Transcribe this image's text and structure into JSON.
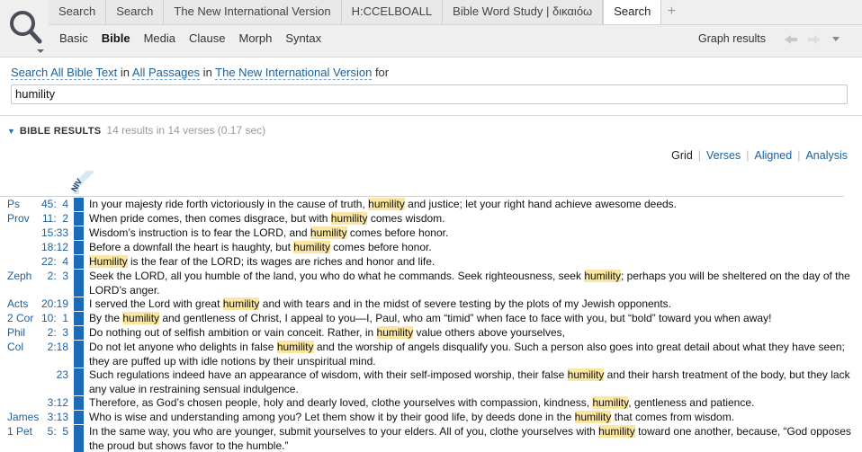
{
  "tabs": [
    "Search",
    "Search",
    "The New International Version",
    "H:CCELBOALL",
    "Bible Word Study | δικαιόω",
    "Search"
  ],
  "tab_add": "+",
  "subnav": [
    "Basic",
    "Bible",
    "Media",
    "Clause",
    "Morph",
    "Syntax"
  ],
  "graph_results": "Graph results",
  "query": {
    "prefix": "Search All Bible Text",
    "in1": " in ",
    "passages": "All Passages",
    "in2": " in ",
    "version": "The New International Version",
    "for": " for",
    "value": "humility"
  },
  "results_header": {
    "title": "BIBLE RESULTS",
    "count": "14 results in 14 verses (0.17 sec)"
  },
  "views": [
    "Grid",
    "Verses",
    "Aligned",
    "Analysis"
  ],
  "version_abbrev": "NIV",
  "colors": {
    "link": "#1f5f99",
    "accent": "#1c6bb8",
    "highlight": "#fbe6a2"
  },
  "results": [
    {
      "book": "Ps",
      "cv": "45:  4",
      "segs": [
        "In your majesty ride forth victoriously in the cause of truth, ",
        "humility",
        " and justice; let your right hand achieve awesome deeds."
      ]
    },
    {
      "book": "Prov",
      "cv": "11:  2",
      "segs": [
        "When pride comes, then comes disgrace, but with ",
        "humility",
        " comes wisdom."
      ]
    },
    {
      "book": "",
      "cv": "15:33",
      "segs": [
        "Wisdom’s instruction is to fear the L",
        "ORD",
        ", and ",
        "humility",
        " comes before honor."
      ],
      "lord_index": 1
    },
    {
      "book": "",
      "cv": "18:12",
      "segs": [
        "Before a downfall the heart is haughty, but ",
        "humility",
        " comes before honor."
      ]
    },
    {
      "book": "",
      "cv": "22:  4",
      "segs": [
        "",
        "Humility",
        " is the fear of the L",
        "ORD",
        "; its wages are riches and honor and life."
      ],
      "lord_index": 3
    },
    {
      "book": "Zeph",
      "cv": "2:  3",
      "lines": 2,
      "segs": [
        "Seek the L",
        "ORD",
        ", all you humble of the land, you who do what he commands. Seek righteousness, seek ",
        "humility",
        "; perhaps you will be sheltered on the day of the L",
        "ORD",
        "’s anger."
      ],
      "lord_index": 1,
      "lord_index2": 5
    },
    {
      "book": "Acts",
      "cv": "20:19",
      "segs": [
        "I served the Lord with great ",
        "humility",
        " and with tears and in the midst of severe testing by the plots of my Jewish opponents."
      ]
    },
    {
      "book": "2 Cor",
      "cv": "10:  1",
      "segs": [
        "By the ",
        "humility",
        " and gentleness of Christ, I appeal to you—I, Paul, who am “timid” when face to face with you, but “bold” toward you when away!"
      ]
    },
    {
      "book": "Phil",
      "cv": "2:  3",
      "segs": [
        "Do nothing out of selfish ambition or vain conceit. Rather, in ",
        "humility",
        " value others above yourselves,"
      ]
    },
    {
      "book": "Col",
      "cv": "2:18",
      "lines": 2,
      "segs": [
        "Do not let anyone who delights in false ",
        "humility",
        " and the worship of angels disqualify you. Such a person also goes into great detail about what they have seen; they are puffed up with idle notions by their unspiritual mind."
      ]
    },
    {
      "book": "",
      "cv": "23",
      "lines": 2,
      "segs": [
        "Such regulations indeed have an appearance of wisdom, with their self-imposed worship, their false ",
        "humility",
        " and their harsh treatment of the body, but they lack any value in restraining sensual indulgence."
      ]
    },
    {
      "book": "",
      "cv": "3:12",
      "segs": [
        "Therefore, as God’s chosen people, holy and dearly loved, clothe yourselves with compassion, kindness, ",
        "humility",
        ", gentleness and patience."
      ]
    },
    {
      "book": "James",
      "cv": "3:13",
      "segs": [
        "Who is wise and understanding among you? Let them show it by their good life, by deeds done in the ",
        "humility",
        " that comes from wisdom."
      ]
    },
    {
      "book": "1 Pet",
      "cv": "5:  5",
      "lines": 2,
      "segs": [
        "In the same way, you who are younger, submit yourselves to your elders. All of you, clothe yourselves with ",
        "humility",
        " toward one another, because, “God opposes the proud but shows favor to the humble.”"
      ]
    }
  ]
}
